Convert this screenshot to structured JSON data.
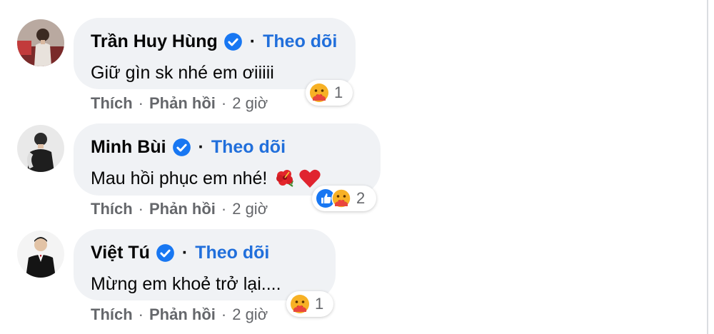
{
  "comments": [
    {
      "author": "Trần Huy Hùng",
      "separator": "·",
      "follow_label": "Theo dõi",
      "text": "Giữ gìn sk nhé em ơiiiii",
      "emojis": [],
      "reactions": [
        "care"
      ],
      "reaction_count": "1",
      "actions": {
        "like": "Thích",
        "reply": "Phản hồi",
        "time": "2 giờ"
      }
    },
    {
      "author": "Minh Bùi",
      "separator": "·",
      "follow_label": "Theo dõi",
      "text": "Mau hồi phục em nhé!",
      "emojis": [
        "hibiscus-emoji",
        "red-heart-emoji"
      ],
      "reactions": [
        "like",
        "care"
      ],
      "reaction_count": "2",
      "actions": {
        "like": "Thích",
        "reply": "Phản hồi",
        "time": "2 giờ"
      }
    },
    {
      "author": "Việt Tú",
      "separator": "·",
      "follow_label": "Theo dõi",
      "text": "Mừng em khoẻ trở lại....",
      "emojis": [],
      "reactions": [
        "care"
      ],
      "reaction_count": "1",
      "actions": {
        "like": "Thích",
        "reply": "Phản hồi",
        "time": "2 giờ"
      }
    }
  ],
  "action_separator": "·",
  "colors": {
    "bubble": "#f0f2f5",
    "link_blue": "#216fdb",
    "verified_blue": "#1877f2",
    "secondary_text": "#65676b",
    "primary_text": "#050505"
  }
}
